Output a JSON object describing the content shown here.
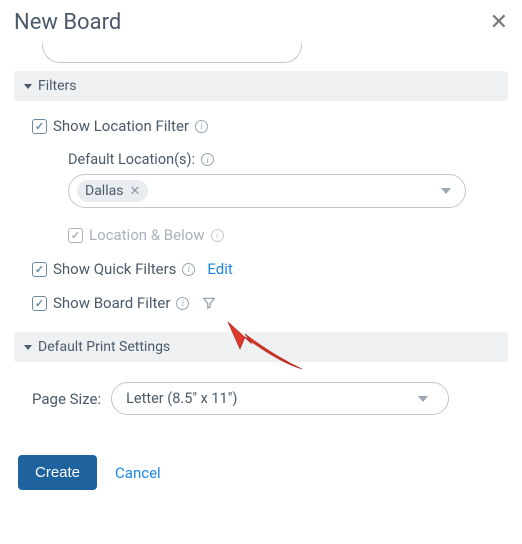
{
  "header": {
    "title": "New Board"
  },
  "sections": {
    "filters": {
      "title": "Filters",
      "show_location_label": "Show Location Filter",
      "default_locations_label": "Default Location(s):",
      "location_tag": "Dallas",
      "location_below_label": "Location & Below",
      "show_quick_filters_label": "Show Quick Filters",
      "edit_label": "Edit",
      "show_board_filter_label": "Show Board Filter"
    },
    "print": {
      "title": "Default Print Settings",
      "page_size_label": "Page Size:",
      "page_size_value": "Letter (8.5\" x 11\")"
    }
  },
  "footer": {
    "create_label": "Create",
    "cancel_label": "Cancel"
  }
}
